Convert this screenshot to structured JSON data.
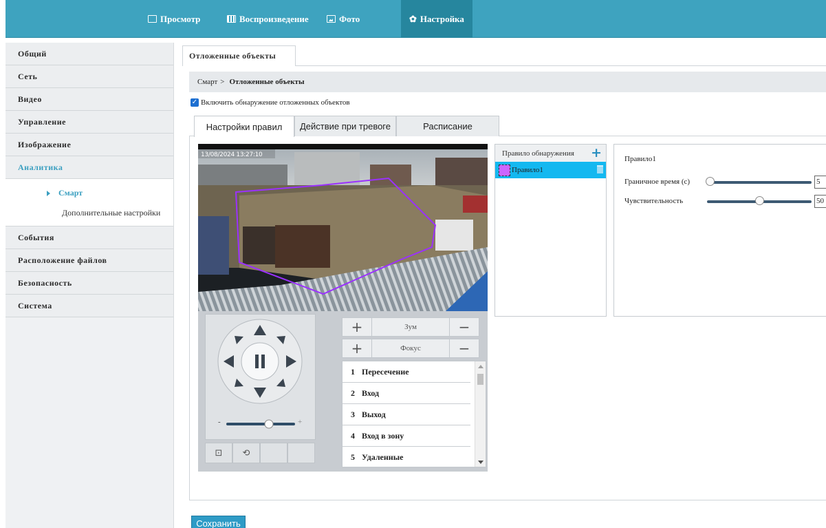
{
  "nav": {
    "items": [
      {
        "label": "Просмотр",
        "icon": "monitor-icon"
      },
      {
        "label": "Воспроизведение",
        "icon": "film-icon"
      },
      {
        "label": "Фото",
        "icon": "photo-icon"
      },
      {
        "label": "Настройка",
        "icon": "gear-icon"
      }
    ],
    "active": "Настройка"
  },
  "sidebar": {
    "items": [
      {
        "label": "Общий"
      },
      {
        "label": "Сеть"
      },
      {
        "label": "Видео"
      },
      {
        "label": "Управление"
      },
      {
        "label": "Изображение"
      },
      {
        "label": "Аналитика"
      },
      {
        "label": "События"
      },
      {
        "label": "Расположение файлов"
      },
      {
        "label": "Безопасность"
      },
      {
        "label": "Система"
      }
    ],
    "active": "Аналитика",
    "sub_items": [
      {
        "label": "Смарт"
      },
      {
        "label": "Дополнительные настройки"
      }
    ]
  },
  "page": {
    "tab": "Отложенные объекты",
    "breadcrumb": {
      "parent": "Смарт",
      "separator": ">",
      "current": "Отложенные объекты"
    },
    "enable_label": "Включить обнаружение отложенных объектов",
    "enable_checked": true,
    "check_glyph": "✓"
  },
  "tabs": [
    {
      "label": "Настройки правил",
      "active": true
    },
    {
      "label": "Действие при тревоге",
      "active": false
    },
    {
      "label": "Расписание",
      "active": false
    }
  ],
  "video": {
    "timestamp": "13/08/2024 13:27:10"
  },
  "ptz": {
    "speed_min": "-",
    "speed_max": "+",
    "speed_level": 0.62,
    "icon_names": [
      "snapshot-icon",
      "3d-positioning-icon"
    ]
  },
  "zoom": {
    "label": "Зум",
    "plus": "+",
    "minus": "−"
  },
  "focus": {
    "label": "Фокус",
    "plus": "+",
    "minus": "−"
  },
  "presets": [
    {
      "num": "1",
      "name": "Пересечение"
    },
    {
      "num": "2",
      "name": "Вход"
    },
    {
      "num": "3",
      "name": "Выход"
    },
    {
      "num": "4",
      "name": "Вход в зону"
    },
    {
      "num": "5",
      "name": "Удаленные"
    }
  ],
  "rules": {
    "header": "Правило обнаружения",
    "add_glyph": "+",
    "items": [
      {
        "name": "Правило1",
        "color": "#cc66ff",
        "selected": true
      }
    ]
  },
  "rule_settings": {
    "title": "Правило1",
    "boundary_time": {
      "label": "Граничное время (с)",
      "value": "5",
      "level": 0.0
    },
    "sensitivity": {
      "label": "Чувствительность",
      "value": "50",
      "level": 0.5
    }
  },
  "save_label": "Сохранить",
  "colors": {
    "accent": "#3ea3bf",
    "selected_row": "#14b8f0",
    "rule_polygon": "#9b30ff",
    "save_button": "#2e9bc6"
  }
}
